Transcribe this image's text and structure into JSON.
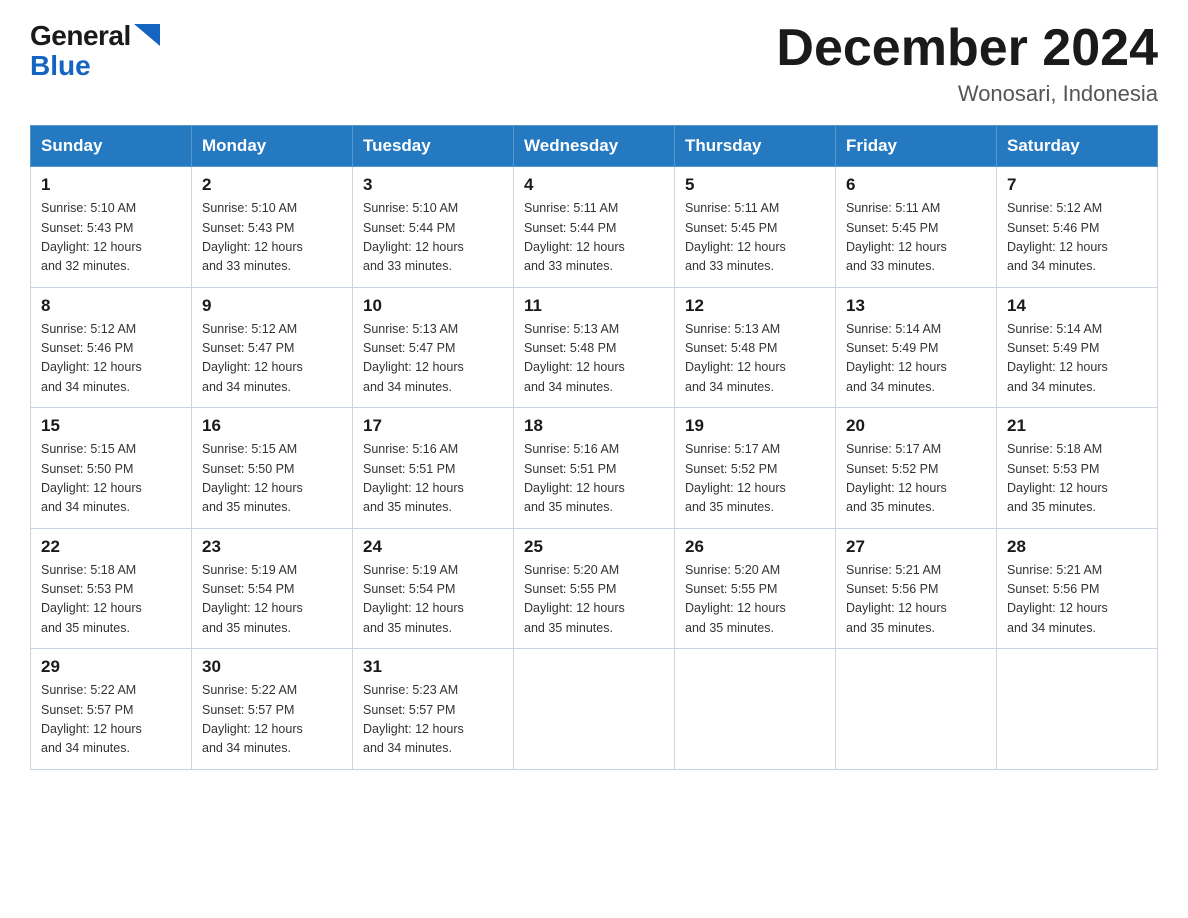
{
  "header": {
    "logo_general": "General",
    "logo_blue": "Blue",
    "title": "December 2024",
    "subtitle": "Wonosari, Indonesia"
  },
  "columns": [
    "Sunday",
    "Monday",
    "Tuesday",
    "Wednesday",
    "Thursday",
    "Friday",
    "Saturday"
  ],
  "weeks": [
    [
      {
        "day": "1",
        "sunrise": "5:10 AM",
        "sunset": "5:43 PM",
        "daylight": "12 hours and 32 minutes."
      },
      {
        "day": "2",
        "sunrise": "5:10 AM",
        "sunset": "5:43 PM",
        "daylight": "12 hours and 33 minutes."
      },
      {
        "day": "3",
        "sunrise": "5:10 AM",
        "sunset": "5:44 PM",
        "daylight": "12 hours and 33 minutes."
      },
      {
        "day": "4",
        "sunrise": "5:11 AM",
        "sunset": "5:44 PM",
        "daylight": "12 hours and 33 minutes."
      },
      {
        "day": "5",
        "sunrise": "5:11 AM",
        "sunset": "5:45 PM",
        "daylight": "12 hours and 33 minutes."
      },
      {
        "day": "6",
        "sunrise": "5:11 AM",
        "sunset": "5:45 PM",
        "daylight": "12 hours and 33 minutes."
      },
      {
        "day": "7",
        "sunrise": "5:12 AM",
        "sunset": "5:46 PM",
        "daylight": "12 hours and 34 minutes."
      }
    ],
    [
      {
        "day": "8",
        "sunrise": "5:12 AM",
        "sunset": "5:46 PM",
        "daylight": "12 hours and 34 minutes."
      },
      {
        "day": "9",
        "sunrise": "5:12 AM",
        "sunset": "5:47 PM",
        "daylight": "12 hours and 34 minutes."
      },
      {
        "day": "10",
        "sunrise": "5:13 AM",
        "sunset": "5:47 PM",
        "daylight": "12 hours and 34 minutes."
      },
      {
        "day": "11",
        "sunrise": "5:13 AM",
        "sunset": "5:48 PM",
        "daylight": "12 hours and 34 minutes."
      },
      {
        "day": "12",
        "sunrise": "5:13 AM",
        "sunset": "5:48 PM",
        "daylight": "12 hours and 34 minutes."
      },
      {
        "day": "13",
        "sunrise": "5:14 AM",
        "sunset": "5:49 PM",
        "daylight": "12 hours and 34 minutes."
      },
      {
        "day": "14",
        "sunrise": "5:14 AM",
        "sunset": "5:49 PM",
        "daylight": "12 hours and 34 minutes."
      }
    ],
    [
      {
        "day": "15",
        "sunrise": "5:15 AM",
        "sunset": "5:50 PM",
        "daylight": "12 hours and 34 minutes."
      },
      {
        "day": "16",
        "sunrise": "5:15 AM",
        "sunset": "5:50 PM",
        "daylight": "12 hours and 35 minutes."
      },
      {
        "day": "17",
        "sunrise": "5:16 AM",
        "sunset": "5:51 PM",
        "daylight": "12 hours and 35 minutes."
      },
      {
        "day": "18",
        "sunrise": "5:16 AM",
        "sunset": "5:51 PM",
        "daylight": "12 hours and 35 minutes."
      },
      {
        "day": "19",
        "sunrise": "5:17 AM",
        "sunset": "5:52 PM",
        "daylight": "12 hours and 35 minutes."
      },
      {
        "day": "20",
        "sunrise": "5:17 AM",
        "sunset": "5:52 PM",
        "daylight": "12 hours and 35 minutes."
      },
      {
        "day": "21",
        "sunrise": "5:18 AM",
        "sunset": "5:53 PM",
        "daylight": "12 hours and 35 minutes."
      }
    ],
    [
      {
        "day": "22",
        "sunrise": "5:18 AM",
        "sunset": "5:53 PM",
        "daylight": "12 hours and 35 minutes."
      },
      {
        "day": "23",
        "sunrise": "5:19 AM",
        "sunset": "5:54 PM",
        "daylight": "12 hours and 35 minutes."
      },
      {
        "day": "24",
        "sunrise": "5:19 AM",
        "sunset": "5:54 PM",
        "daylight": "12 hours and 35 minutes."
      },
      {
        "day": "25",
        "sunrise": "5:20 AM",
        "sunset": "5:55 PM",
        "daylight": "12 hours and 35 minutes."
      },
      {
        "day": "26",
        "sunrise": "5:20 AM",
        "sunset": "5:55 PM",
        "daylight": "12 hours and 35 minutes."
      },
      {
        "day": "27",
        "sunrise": "5:21 AM",
        "sunset": "5:56 PM",
        "daylight": "12 hours and 35 minutes."
      },
      {
        "day": "28",
        "sunrise": "5:21 AM",
        "sunset": "5:56 PM",
        "daylight": "12 hours and 34 minutes."
      }
    ],
    [
      {
        "day": "29",
        "sunrise": "5:22 AM",
        "sunset": "5:57 PM",
        "daylight": "12 hours and 34 minutes."
      },
      {
        "day": "30",
        "sunrise": "5:22 AM",
        "sunset": "5:57 PM",
        "daylight": "12 hours and 34 minutes."
      },
      {
        "day": "31",
        "sunrise": "5:23 AM",
        "sunset": "5:57 PM",
        "daylight": "12 hours and 34 minutes."
      },
      null,
      null,
      null,
      null
    ]
  ],
  "labels": {
    "sunrise": "Sunrise:",
    "sunset": "Sunset:",
    "daylight": "Daylight:"
  }
}
